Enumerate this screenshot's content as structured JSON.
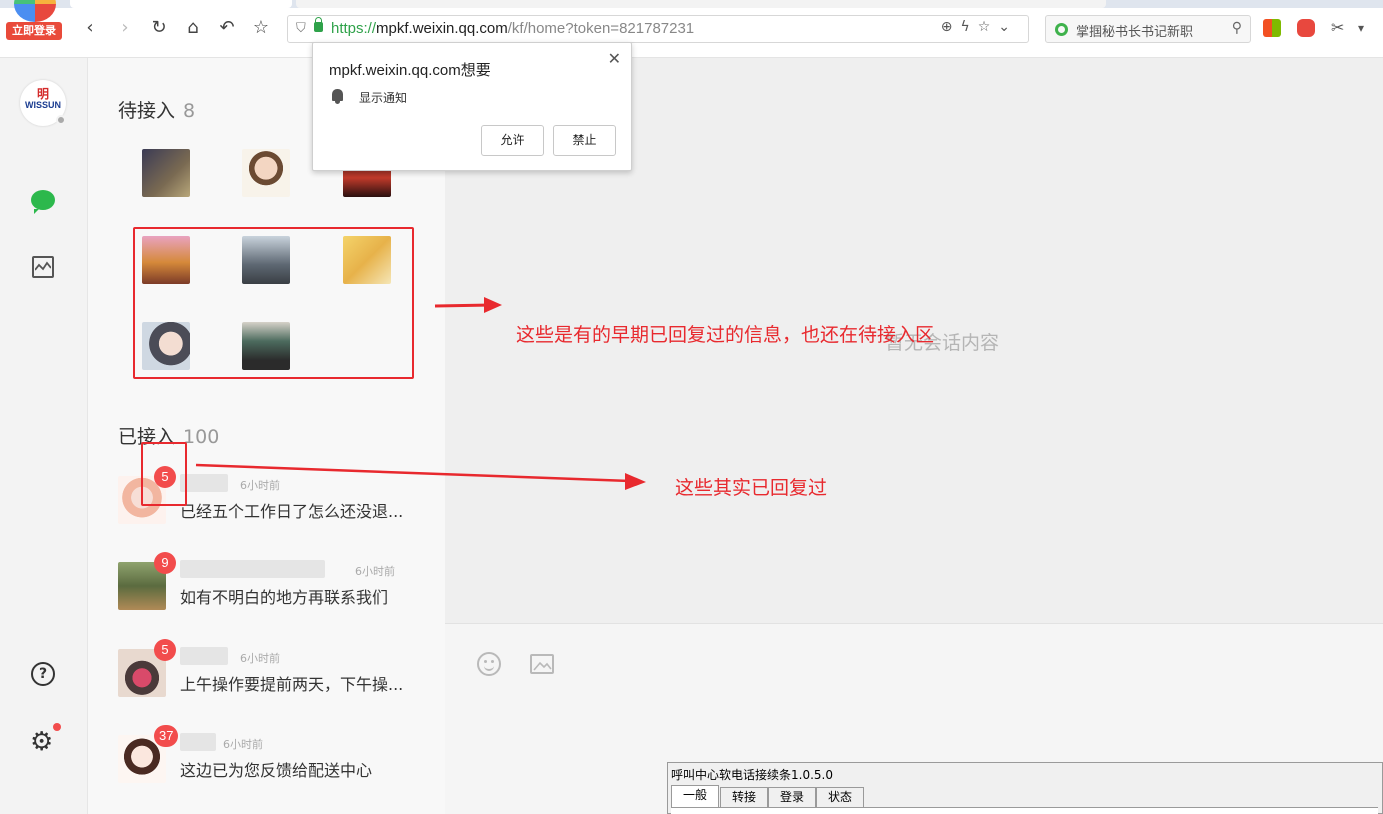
{
  "browser": {
    "login_button": "立即登录",
    "url": {
      "scheme": "https://",
      "host": "mpkf.weixin.qq.com",
      "path": "/kf/home?token=821787231"
    },
    "search_placeholder": "掌掴秘书长书记新职"
  },
  "rail": {
    "brand_top": "明",
    "brand_bottom": "WISSUN",
    "help_label": "?"
  },
  "waiting": {
    "title": "待接入",
    "count": "8"
  },
  "accepted": {
    "title": "已接入",
    "count": "100",
    "conversations": [
      {
        "badge": "5",
        "time": "6小时前",
        "message": "已经五个工作日了怎么还没退..."
      },
      {
        "badge": "9",
        "time": "6小时前",
        "message": "如有不明白的地方再联系我们"
      },
      {
        "badge": "5",
        "time": "6小时前",
        "message": "上午操作要提前两天，下午操..."
      },
      {
        "badge": "37",
        "time": "6小时前",
        "message": "这边已为您反馈给配送中心"
      }
    ]
  },
  "main": {
    "empty_text": "暂无会话内容"
  },
  "annotations": {
    "waiting_note": "这些是有的早期已回复过的信息，也还在待接入区",
    "accepted_note": "这些其实已回复过"
  },
  "permission_popup": {
    "title": "mpkf.weixin.qq.com想要",
    "description": "显示通知",
    "allow": "允许",
    "block": "禁止"
  },
  "call_window": {
    "title": "呼叫中心软电话接续条1.0.5.0",
    "tabs": [
      "一般",
      "转接",
      "登录",
      "状态"
    ]
  },
  "colors": {
    "accent_green": "#2cb84c",
    "badge_red": "#f24c4c",
    "annotation_red": "#e8292e"
  }
}
